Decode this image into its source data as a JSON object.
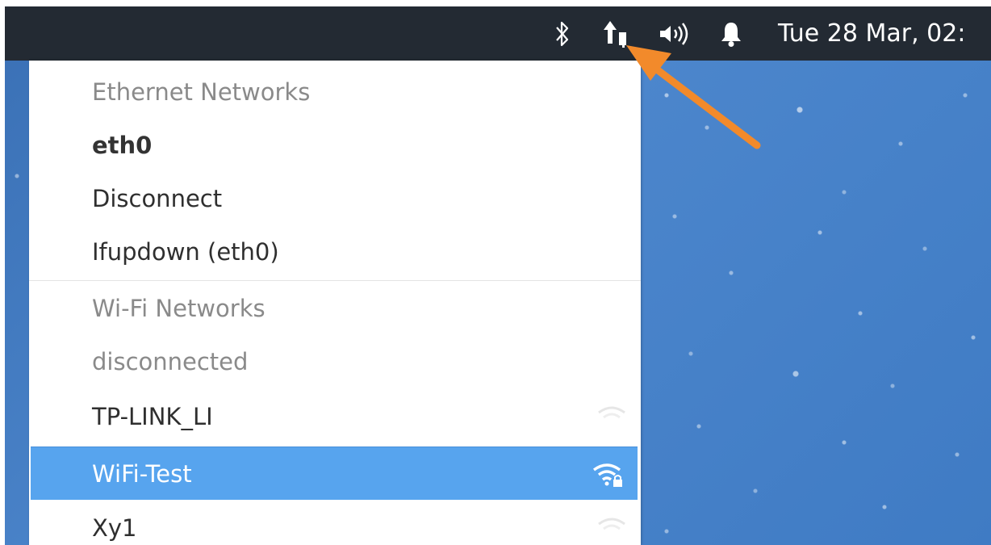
{
  "panel": {
    "clock_text": "Tue 28 Mar, 02:",
    "icons": [
      "bluetooth-icon",
      "network-icon",
      "volume-icon",
      "notification-bell-icon"
    ]
  },
  "network_menu": {
    "ethernet_header": "Ethernet Networks",
    "ethernet_device": "eth0",
    "disconnect_label": "Disconnect",
    "ethernet_connection": "Ifupdown (eth0)",
    "wifi_header": "Wi-Fi Networks",
    "wifi_status": "disconnected",
    "wifi_networks": [
      {
        "ssid": "TP-LINK_LI",
        "selected": false,
        "signal_icon": "wifi-signal-weak-icon"
      },
      {
        "ssid": "WiFi-Test",
        "selected": true,
        "signal_icon": "wifi-signal-secured-icon"
      },
      {
        "ssid": "Xy1",
        "selected": false,
        "signal_icon": "wifi-signal-weak-icon"
      }
    ]
  },
  "annotation": {
    "arrow_color": "#f28a2b",
    "points_to": "network-icon"
  },
  "colors": {
    "panel_bg": "#232a33",
    "selection": "#57a4ee",
    "desktop": "#4c86cc"
  }
}
